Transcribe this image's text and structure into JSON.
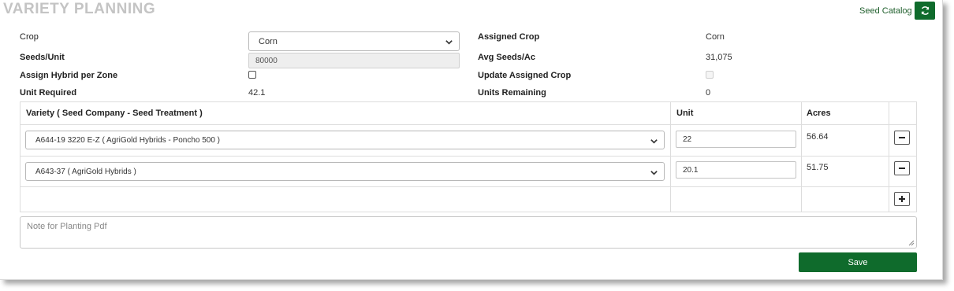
{
  "header": {
    "title": "VARIETY PLANNING",
    "seed_catalog_link": "Seed Catalog",
    "refresh_icon": "refresh-icon"
  },
  "form": {
    "crop_label": "Crop",
    "crop_value": "Corn",
    "seeds_per_unit_label": "Seeds/Unit",
    "seeds_per_unit_value": "80000",
    "assign_hybrid_label": "Assign Hybrid per Zone",
    "assign_hybrid_checked": false,
    "unit_required_label": "Unit Required",
    "unit_required_value": "42.1",
    "assigned_crop_label": "Assigned Crop",
    "assigned_crop_value": "Corn",
    "avg_seeds_label": "Avg Seeds/Ac",
    "avg_seeds_value": "31,075",
    "update_assigned_label": "Update Assigned Crop",
    "update_assigned_checked": false,
    "units_remaining_label": "Units Remaining",
    "units_remaining_value": "0"
  },
  "table": {
    "headers": {
      "variety": "Variety ( Seed Company - Seed Treatment )",
      "unit": "Unit",
      "acres": "Acres"
    },
    "rows": [
      {
        "variety": "A644-19 3220 E-Z ( AgriGold Hybrids - Poncho 500 )",
        "unit": "22",
        "acres": "56.64"
      },
      {
        "variety": "A643-37 ( AgriGold Hybrids )",
        "unit": "20.1",
        "acres": "51.75"
      }
    ]
  },
  "note": {
    "placeholder": "Note for Planting Pdf"
  },
  "save_label": "Save",
  "colors": {
    "brand_green": "#0f6b2c",
    "title_gray": "#c4c4c4"
  }
}
